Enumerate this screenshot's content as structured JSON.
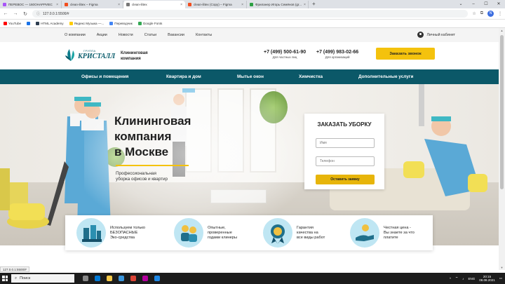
{
  "browser": {
    "tabs": [
      {
        "title": "ПЕРЕВОС — 160ОНАРРИЕС",
        "color": "#a855f7",
        "active": false
      },
      {
        "title": "clean-ilitex – Figma",
        "color": "#f24e1e",
        "active": false
      },
      {
        "title": "clean-ilitex",
        "color": "#777777",
        "active": true
      },
      {
        "title": "clean-ilitex (Copy) – Figma",
        "color": "#f24e1e",
        "active": false
      },
      {
        "title": "Фриланер Игорь Семёнов (gr...",
        "color": "#2ea043",
        "active": false
      }
    ],
    "new_tab": "+",
    "url": "127.0.0.1:5500/#",
    "profile_letter": "N",
    "bookmarks": [
      {
        "label": "YouTube",
        "color": "#ff0000"
      },
      {
        "label": "",
        "color": "#1a73e8"
      },
      {
        "label": "HTML Academy",
        "color": "#2d3e50"
      },
      {
        "label": "Яндекс Музыка —...",
        "color": "#ffcc00"
      },
      {
        "label": "Переводчик",
        "color": "#4285f4"
      },
      {
        "label": "Google Fonts",
        "color": "#34a853"
      }
    ]
  },
  "site": {
    "top_menu": [
      "О компании",
      "Акции",
      "Новости",
      "Статьи",
      "Вакансии",
      "Контакты"
    ],
    "cabinet": "Личный кабинет",
    "logo_small": "ГРУППА",
    "logo_big": "КРИСТАЛЛ",
    "company_line1": "Клининговая",
    "company_line2": "компания",
    "phones": [
      {
        "number": "+7 (499) 500-61-90",
        "label": "Для частных лиц"
      },
      {
        "number": "+7 (499) 983-02-66",
        "label": "Для организаций"
      }
    ],
    "call_button": "Заказать звонок",
    "main_menu": [
      "Офисы и помещения",
      "Квартира и дом",
      "Мытье окон",
      "Химчистка",
      "Дополнительные услуги"
    ],
    "hero": {
      "title_l1": "Клининговая",
      "title_l2": "компания",
      "title_l3": "в Москве",
      "subtitle_l1": "Профессиональная",
      "subtitle_l2": "уборка офисов и квартир"
    },
    "order_form": {
      "title": "ЗАКАЗАТЬ УБОРКУ",
      "name_placeholder": "Имя",
      "phone_placeholder": "Телефон",
      "submit": "Оставить заявку"
    },
    "features": [
      {
        "icon": "cleaning-supplies-icon",
        "l1": "Используем только",
        "l2": "БЕЗОПАСНЫЕ",
        "l3": "Эко-средства"
      },
      {
        "icon": "cleaners-icon",
        "l1": "Опытные,",
        "l2": "проверенные",
        "l3": "годами клинеры"
      },
      {
        "icon": "quality-medal-icon",
        "l1": "Гарантия",
        "l2": "качества на",
        "l3": "все виды работ"
      },
      {
        "icon": "fair-price-icon",
        "l1": "Честная цена -",
        "l2": "Вы знаете за что",
        "l3": "платите"
      }
    ]
  },
  "status_url": "127.0.0.1:5500/#",
  "taskbar": {
    "search": "Поиск",
    "lang": "ENG",
    "time": "20:15",
    "date": "08.08.2021"
  },
  "colors": {
    "accent": "#f4c20d",
    "nav_teal": "#0b5868",
    "icon_bg": "#bfe6f3"
  }
}
